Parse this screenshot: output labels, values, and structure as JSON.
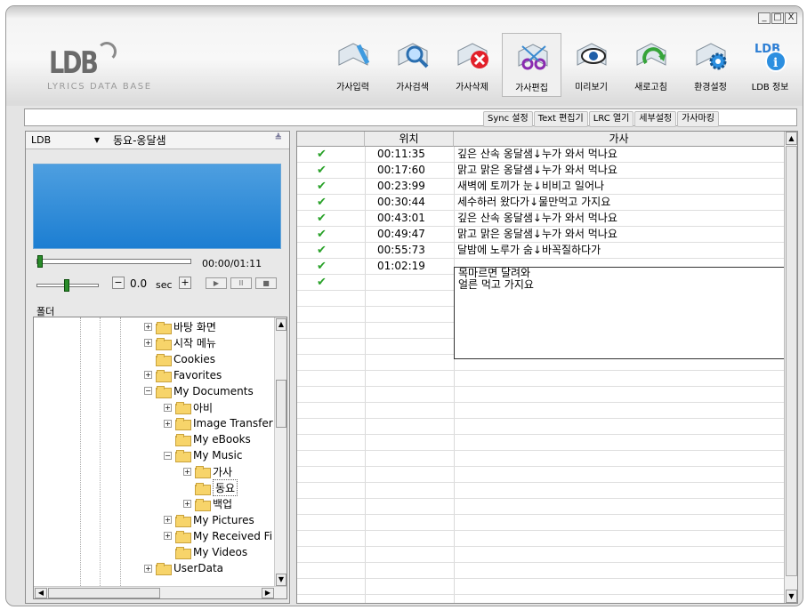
{
  "window": {
    "controls": [
      "_",
      "□",
      "X"
    ]
  },
  "logo": {
    "mark": "LDB",
    "subtitle": "LYRICS DATA BASE"
  },
  "toolbar": [
    {
      "label": "가사입력",
      "icon": "book-pen-icon",
      "active": false
    },
    {
      "label": "가사검색",
      "icon": "book-magnifier-icon",
      "active": false
    },
    {
      "label": "가사삭제",
      "icon": "book-delete-icon",
      "active": false
    },
    {
      "label": "가사편집",
      "icon": "book-scissors-icon",
      "active": true
    },
    {
      "label": "미리보기",
      "icon": "book-eye-icon",
      "active": false
    },
    {
      "label": "새로고침",
      "icon": "book-refresh-icon",
      "active": false
    },
    {
      "label": "환경설정",
      "icon": "book-gear-icon",
      "active": false
    },
    {
      "label": "LDB 정보",
      "icon": "ldb-info-icon",
      "active": false
    }
  ],
  "sync_buttons": [
    "Sync 설정",
    "Text 편집기",
    "LRC 열기",
    "세부설정",
    "가사마킹"
  ],
  "player": {
    "source": "LDB",
    "song": "동요-옹달샘",
    "time": "00:00/01:11",
    "offset_value": "0.0",
    "offset_unit": "sec",
    "seek_fraction": 0.0,
    "controls": [
      "▶",
      "II",
      "■"
    ]
  },
  "folder": {
    "header": "폴더",
    "items": [
      {
        "label": "바탕 화면",
        "depth": 0,
        "toggle": "+"
      },
      {
        "label": "시작 메뉴",
        "depth": 0,
        "toggle": "+"
      },
      {
        "label": "Cookies",
        "depth": 0,
        "toggle": ""
      },
      {
        "label": "Favorites",
        "depth": 0,
        "toggle": "+"
      },
      {
        "label": "My Documents",
        "depth": 0,
        "toggle": "-"
      },
      {
        "label": "아비",
        "depth": 1,
        "toggle": "+"
      },
      {
        "label": "Image Transfer",
        "depth": 1,
        "toggle": "+"
      },
      {
        "label": "My eBooks",
        "depth": 1,
        "toggle": ""
      },
      {
        "label": "My Music",
        "depth": 1,
        "toggle": "-"
      },
      {
        "label": "가사",
        "depth": 2,
        "toggle": "+"
      },
      {
        "label": "동요",
        "depth": 2,
        "toggle": "",
        "selected": true
      },
      {
        "label": "백업",
        "depth": 2,
        "toggle": "+"
      },
      {
        "label": "My Pictures",
        "depth": 1,
        "toggle": "+"
      },
      {
        "label": "My Received Fi",
        "depth": 1,
        "toggle": "+"
      },
      {
        "label": "My Videos",
        "depth": 1,
        "toggle": ""
      },
      {
        "label": "UserData",
        "depth": 0,
        "toggle": "+"
      }
    ]
  },
  "lyrics_table": {
    "columns": [
      "",
      "위치",
      "가사"
    ],
    "rows": [
      {
        "check": "✔",
        "pos": "00:11:35",
        "text": "깊은 산속 옹달샘↓누가 와서 먹나요"
      },
      {
        "check": "✔",
        "pos": "00:17:60",
        "text": "맑고 맑은 옹달샘↓누가 와서 먹나요"
      },
      {
        "check": "✔",
        "pos": "00:23:99",
        "text": "새벽에 토끼가 눈↓비비고 일어나"
      },
      {
        "check": "✔",
        "pos": "00:30:44",
        "text": "세수하러 왔다가↓물만먹고 가지요"
      },
      {
        "check": "✔",
        "pos": "00:43:01",
        "text": "깊은 산속 옹달샘↓누가 와서 먹나요"
      },
      {
        "check": "✔",
        "pos": "00:49:47",
        "text": "맑고 맑은 옹달샘↓누가 와서 먹나요"
      },
      {
        "check": "✔",
        "pos": "00:55:73",
        "text": "달밤에 노루가 숨↓바꼭질하다가"
      },
      {
        "check": "✔",
        "pos": "01:02:19",
        "text": ""
      },
      {
        "check": "✔",
        "pos": "",
        "text": ""
      }
    ],
    "editing_text_line1": "목마르면 달려와",
    "editing_text_line2": "얼른 먹고 가지요"
  }
}
